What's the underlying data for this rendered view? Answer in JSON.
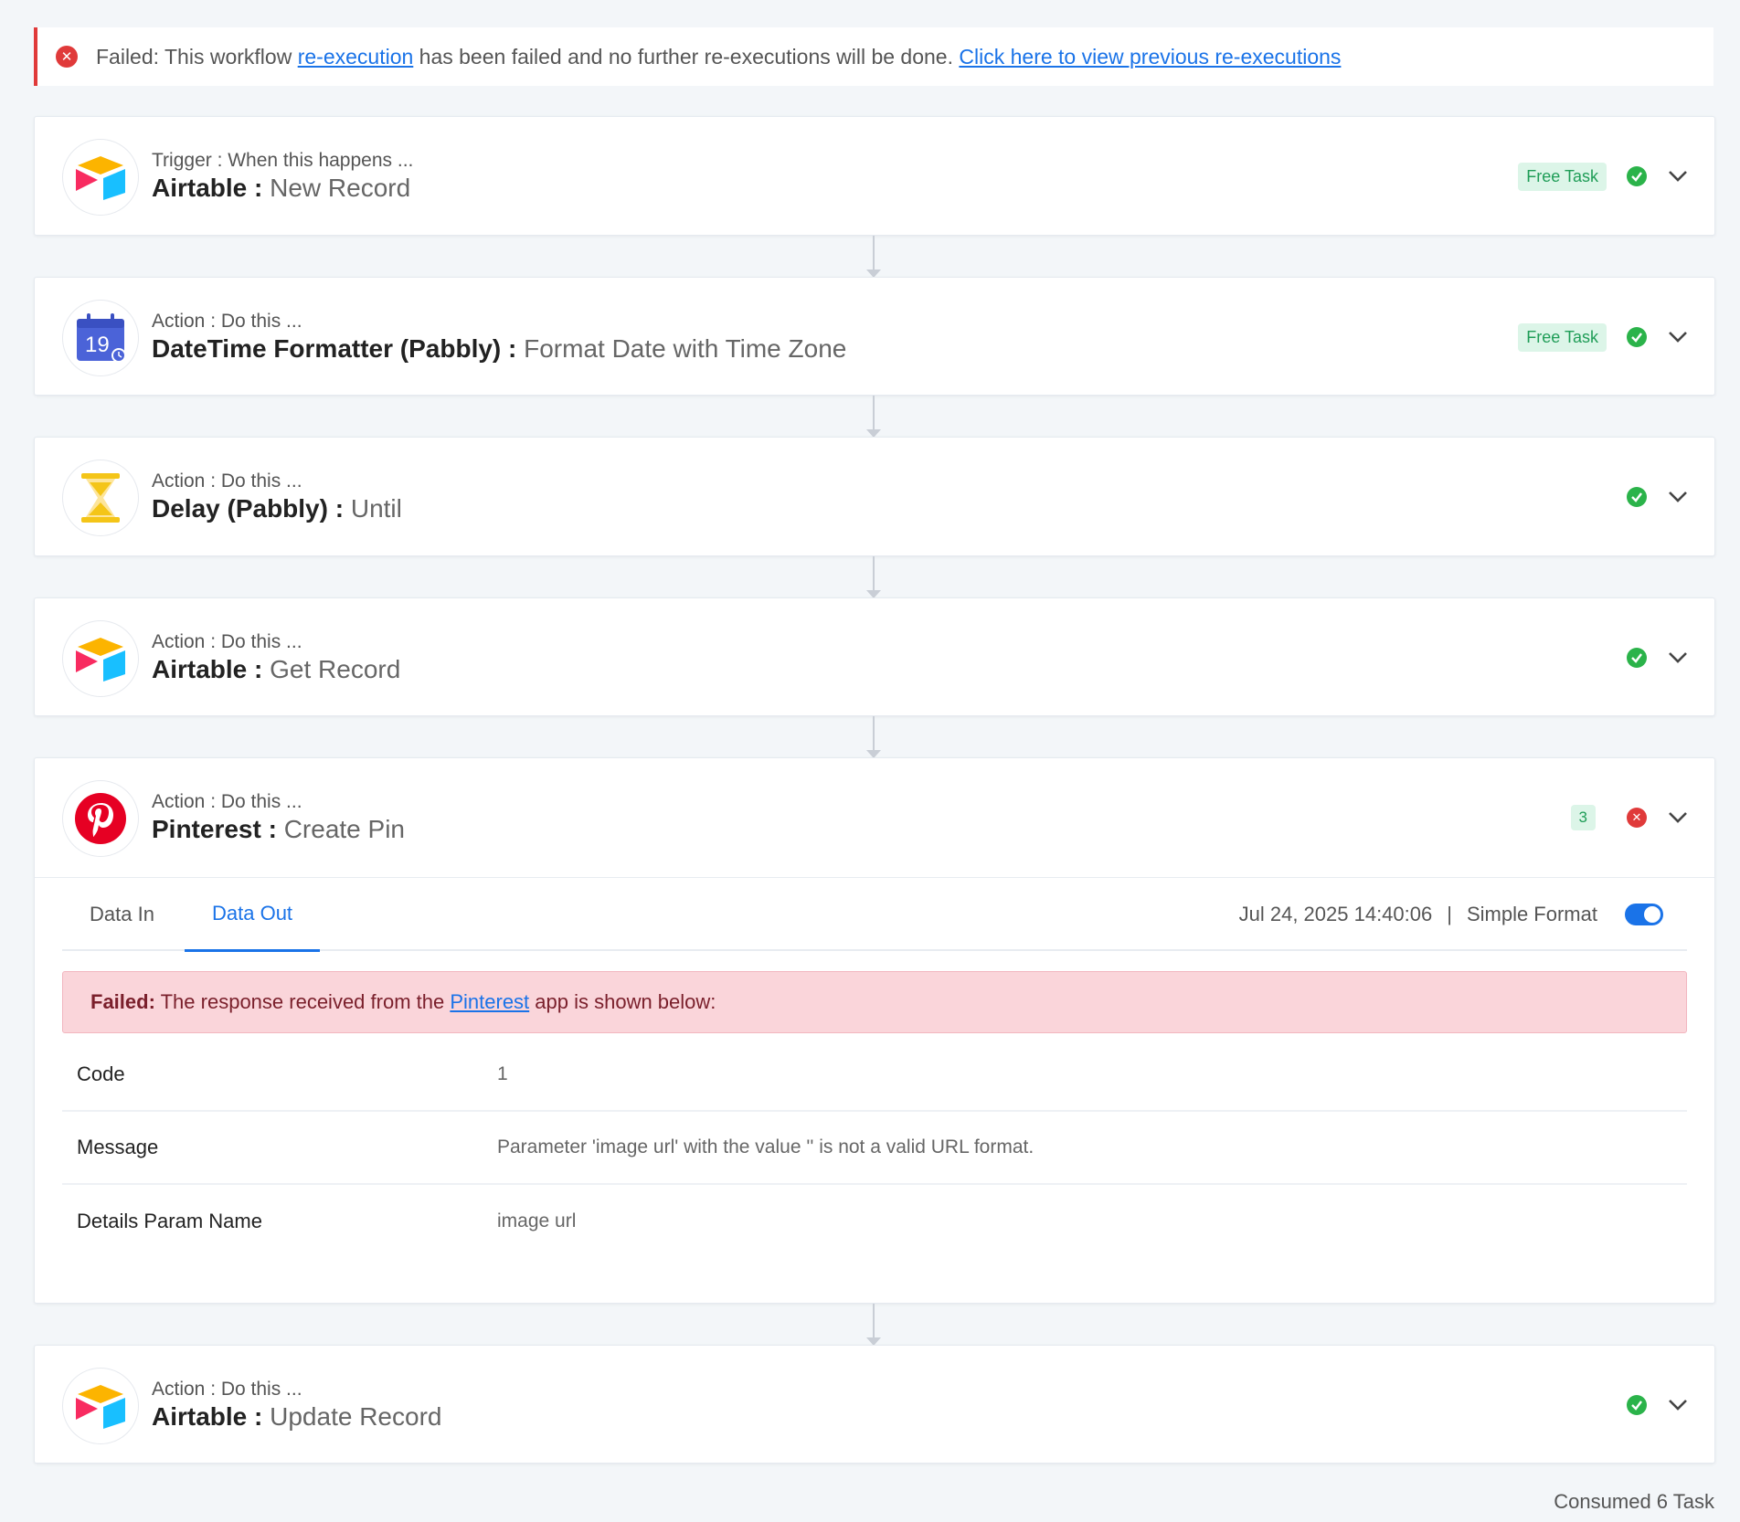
{
  "alert": {
    "prefix": "Failed: This workflow ",
    "link1": "re-execution",
    "middle": " has been failed and no further re-executions will be done. ",
    "link2": "Click here to view previous re-executions"
  },
  "steps": [
    {
      "type": "Trigger : When this happens ...",
      "app": "Airtable : ",
      "event": "New Record",
      "badge": "Free Task",
      "icon": "airtable-icon"
    },
    {
      "type": "Action : Do this ...",
      "app": "DateTime Formatter (Pabbly) : ",
      "event": "Format Date with Time Zone",
      "badge": "Free Task",
      "icon": "calendar-icon",
      "icon_text": "19"
    },
    {
      "type": "Action : Do this ...",
      "app": "Delay (Pabbly) : ",
      "event": "Until",
      "icon": "hourglass-icon"
    },
    {
      "type": "Action : Do this ...",
      "app": "Airtable : ",
      "event": "Get Record",
      "icon": "airtable-icon"
    },
    {
      "type": "Action : Do this ...",
      "app": "Pinterest : ",
      "event": "Create Pin",
      "count": "3",
      "icon": "pinterest-icon"
    },
    {
      "type": "Action : Do this ...",
      "app": "Airtable : ",
      "event": "Update Record",
      "icon": "airtable-icon"
    }
  ],
  "detail": {
    "tabs": [
      "Data In",
      "Data Out"
    ],
    "timestamp": "Jul 24, 2025 14:40:06",
    "separator": "|",
    "format_label": "Simple Format",
    "fail": {
      "strong": "Failed:",
      "text1": " The response received from the ",
      "link": "Pinterest",
      "text2": " app is shown below:"
    },
    "rows": [
      {
        "key": "Code",
        "value": "1"
      },
      {
        "key": "Message",
        "value": "Parameter 'image url' with the value '' is not a valid URL format."
      },
      {
        "key": "Details Param Name",
        "value": "image url"
      }
    ]
  },
  "footer": "Consumed 6 Task",
  "colors": {
    "accent": "#1a73e8",
    "success": "#2bb34a",
    "error": "#e03a3a",
    "badge_bg": "#dcf5e8"
  }
}
